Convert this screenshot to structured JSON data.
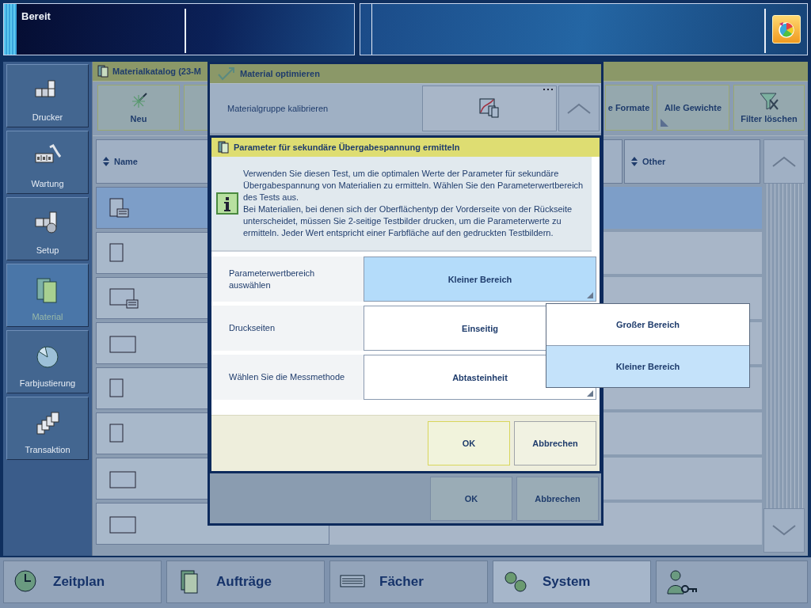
{
  "status_bar": {
    "status": "Bereit"
  },
  "sidebar": {
    "items": [
      {
        "label": "Drucker",
        "selected": false
      },
      {
        "label": "Wartung",
        "selected": false
      },
      {
        "label": "Setup",
        "selected": false
      },
      {
        "label": "Material",
        "selected": true
      },
      {
        "label": "Farbjustierung",
        "selected": false
      },
      {
        "label": "Transaktion",
        "selected": false
      }
    ]
  },
  "catalog": {
    "title": "Materialkatalog (23-M",
    "toolbar": [
      {
        "kind": "new",
        "label": "Neu"
      },
      {
        "kind": "hidden"
      },
      {
        "kind": "spacer"
      },
      {
        "kind": "plain",
        "label": "e Formate"
      },
      {
        "kind": "menu",
        "label": "Alle Gewichte"
      },
      {
        "kind": "clear-filter",
        "label": "Filter löschen"
      }
    ],
    "table": {
      "columns": [
        "Name",
        "",
        "",
        "",
        "Other"
      ],
      "rows": [
        {
          "kind": "portrait-list",
          "selected": true
        },
        {
          "kind": "portrait",
          "selected": false
        },
        {
          "kind": "landscape-list",
          "selected": false
        },
        {
          "kind": "landscape",
          "selected": false
        },
        {
          "kind": "portrait",
          "selected": false
        },
        {
          "kind": "portrait",
          "selected": false
        },
        {
          "kind": "landscape",
          "selected": false
        },
        {
          "kind": "landscape",
          "selected": false
        }
      ]
    }
  },
  "dialog": {
    "title": "Material optimieren",
    "row_label": "Materialgruppe kalibrieren",
    "buttons": [
      "OK",
      "Abbrechen"
    ]
  },
  "subdialog": {
    "title": "Parameter für sekundäre Übergabespannung ermitteln",
    "info": [
      "Verwenden Sie diesen Test, um die optimalen Werte der Parameter für sekundäre Übergabespannung von Materialien zu ermitteln. Wählen Sie den Parameterwertbereich des Tests aus.",
      "Bei Materialien, bei denen sich der Oberflächentyp der Vorderseite von der Rückseite unterscheidet, müssen Sie 2-seitige Testbilder drucken, um die Parameterwerte zu ermitteln. Jeder Wert entspricht einer Farbfläche auf den gedruckten Testbildern."
    ],
    "fields": [
      {
        "label": "Parameterwertbereich auswählen",
        "value": "Kleiner Bereich",
        "expanded": true
      },
      {
        "label": "Druckseiten",
        "value": "Einseitig",
        "expanded": false
      },
      {
        "label": "Wählen Sie die Messmethode",
        "value": "Abtasteinheit",
        "expanded": false
      }
    ],
    "buttons": [
      "OK",
      "Abbrechen"
    ]
  },
  "dropdown": {
    "options": [
      {
        "label": "Großer Bereich",
        "selected": false
      },
      {
        "label": "Kleiner Bereich",
        "selected": true
      }
    ]
  },
  "bottom_tabs": [
    {
      "label": "Zeitplan",
      "selected": false
    },
    {
      "label": "Aufträge",
      "selected": false
    },
    {
      "label": "Fächer",
      "selected": false
    },
    {
      "label": "System",
      "selected": true
    }
  ]
}
